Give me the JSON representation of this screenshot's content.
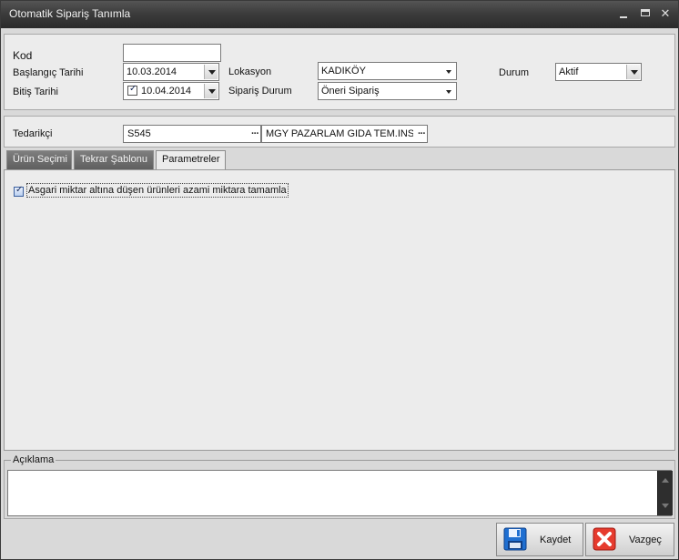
{
  "window": {
    "title": "Otomatik Sipariş Tanımla",
    "controls": {
      "minimize": "minimize-icon",
      "maximize": "maximize-icon",
      "close": "close-icon"
    }
  },
  "header": {
    "kod_label": "Kod",
    "kod_value": "",
    "baslangic_label": "Başlangıç Tarihi",
    "baslangic_value": "10.03.2014",
    "bitis_label": "Bitiş Tarihi",
    "bitis_value": "10.04.2014",
    "bitis_checked": true,
    "lokasyon_label": "Lokasyon",
    "lokasyon_value": "KADIKÖY",
    "siparis_durum_label": "Sipariş Durum",
    "siparis_durum_value": "Öneri Sipariş",
    "durum_label": "Durum",
    "durum_value": "Aktif"
  },
  "supplier": {
    "label": "Tedarikçi",
    "code": "S545",
    "name": "MGY PAZARLAM GIDA TEM.INS.LT"
  },
  "tabs": [
    {
      "label": "Ürün Seçimi",
      "active": false
    },
    {
      "label": "Tekrar Şablonu",
      "active": false
    },
    {
      "label": "Parametreler",
      "active": true
    }
  ],
  "parameters": {
    "option_label": "Asgari miktar altına düşen ürünleri azami miktara tamamla",
    "option_checked": true
  },
  "description": {
    "label": "Açıklama",
    "value": ""
  },
  "buttons": {
    "save_label": "Kaydet",
    "cancel_label": "Vazgeç"
  }
}
